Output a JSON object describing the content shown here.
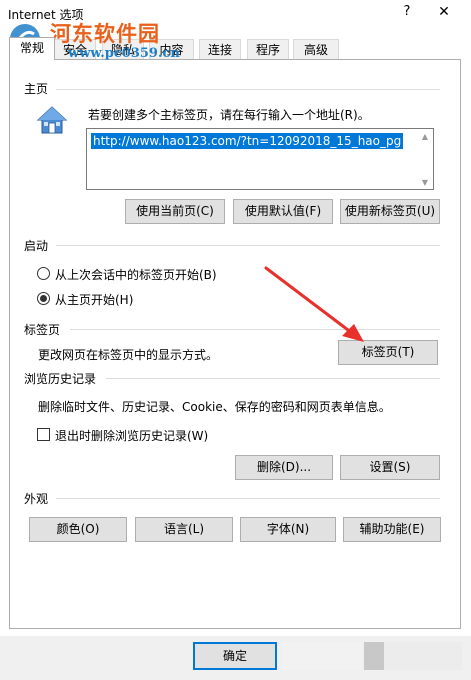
{
  "window": {
    "title": "Internet 选项",
    "help_label": "?",
    "close_label": "✕"
  },
  "tabs": [
    {
      "label": "常规",
      "active": true
    },
    {
      "label": "安全"
    },
    {
      "label": "隐私"
    },
    {
      "label": "内容"
    },
    {
      "label": "连接"
    },
    {
      "label": "程序"
    },
    {
      "label": "高级"
    }
  ],
  "home": {
    "section_title": "主页",
    "hint": "若要创建多个主标签页，请在每行输入一个地址(R)。",
    "url_value": "http://www.hao123.com/?tn=12092018_15_hao_pg",
    "buttons": {
      "use_current": "使用当前页(C)",
      "use_default": "使用默认值(F)",
      "use_new_tab": "使用新标签页(U)"
    }
  },
  "startup": {
    "section_title": "启动",
    "options": [
      {
        "label": "从上次会话中的标签页开始(B)",
        "checked": false
      },
      {
        "label": "从主页开始(H)",
        "checked": true
      }
    ]
  },
  "tabs_section": {
    "section_title": "标签页",
    "description": "更改网页在标签页中的显示方式。",
    "button": "标签页(T)"
  },
  "history": {
    "section_title": "浏览历史记录",
    "description": "删除临时文件、历史记录、Cookie、保存的密码和网页表单信息。",
    "checkbox_label": "退出时删除浏览历史记录(W)",
    "checkbox_checked": false,
    "delete_button": "删除(D)...",
    "settings_button": "设置(S)"
  },
  "appearance": {
    "section_title": "外观",
    "buttons": {
      "colors": "颜色(O)",
      "languages": "语言(L)",
      "fonts": "字体(N)",
      "accessibility": "辅助功能(E)"
    }
  },
  "footer": {
    "ok_button": "确定"
  },
  "watermark": {
    "site_name": "河东软件园",
    "url": "www.pc0359.cn"
  },
  "colors": {
    "accent": "#0078d7",
    "annotation_arrow": "#e8312b",
    "watermark_orange": "#e8601b",
    "watermark_blue": "#1e7fc8"
  }
}
